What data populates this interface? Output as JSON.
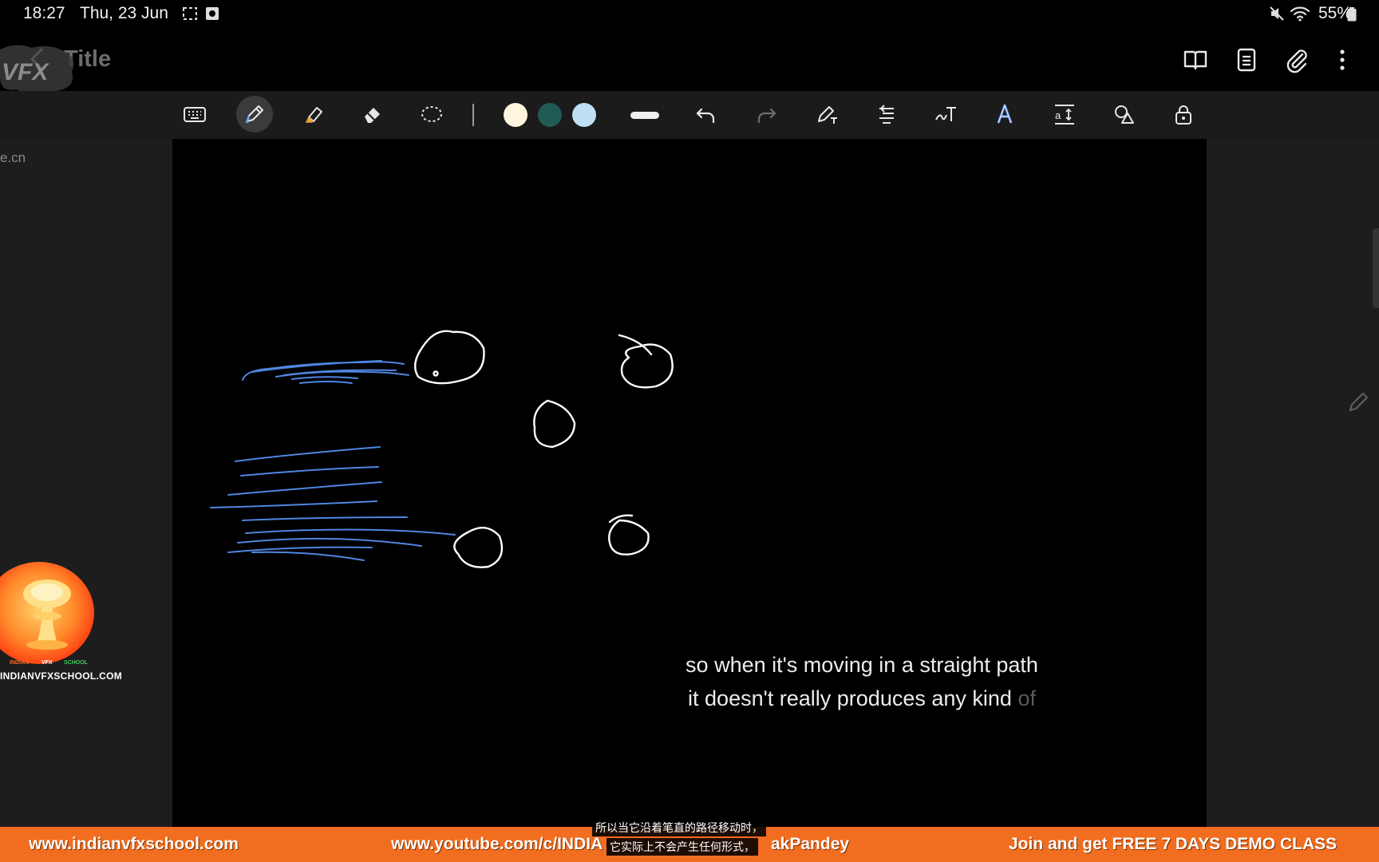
{
  "status_bar": {
    "time": "18:27",
    "date": "Thu, 23 Jun",
    "battery": "55%"
  },
  "title_bar": {
    "title": "Title",
    "watermark_logo_text": "VFX"
  },
  "toolbar": {
    "tools": [
      "keyboard-icon",
      "pen-icon",
      "highlighter-icon",
      "eraser-icon",
      "lasso-icon"
    ],
    "active_tool": "pen",
    "colors": [
      "#fff6df",
      "#1f5a55",
      "#bfdff5"
    ],
    "stroke": "thick",
    "actions": [
      "undo-icon",
      "redo-icon",
      "pen-to-text-icon",
      "text-align-icon",
      "handwriting-icon",
      "text-style-icon",
      "text-resize-icon",
      "shapes-icon",
      "lock-icon"
    ]
  },
  "canvas": {
    "watermark_url": "e.cn",
    "stroke_colors": {
      "blue": "#4f86e0",
      "white": "#ffffff"
    },
    "badge": {
      "word1": "INDIAN",
      "word2": "VFX",
      "word3": "SCHOOL",
      "url": "INDIANVFXSCHOOL.COM"
    },
    "subtitle_line1": "so when it's moving in a straight path",
    "subtitle_line2_main": "it doesn't really produces any kind",
    "subtitle_line2_tail": "of"
  },
  "banner": {
    "website": "www.indianvfxschool.com",
    "youtube_left": "www.youtube.com/c/INDIA",
    "youtube_right": "akPandey",
    "cta": "Join and get FREE 7 DAYS DEMO CLASS",
    "cn_line1": "所以当它沿着笔直的路径移动时，",
    "cn_line2": "它实际上不会产生任何形式，"
  }
}
